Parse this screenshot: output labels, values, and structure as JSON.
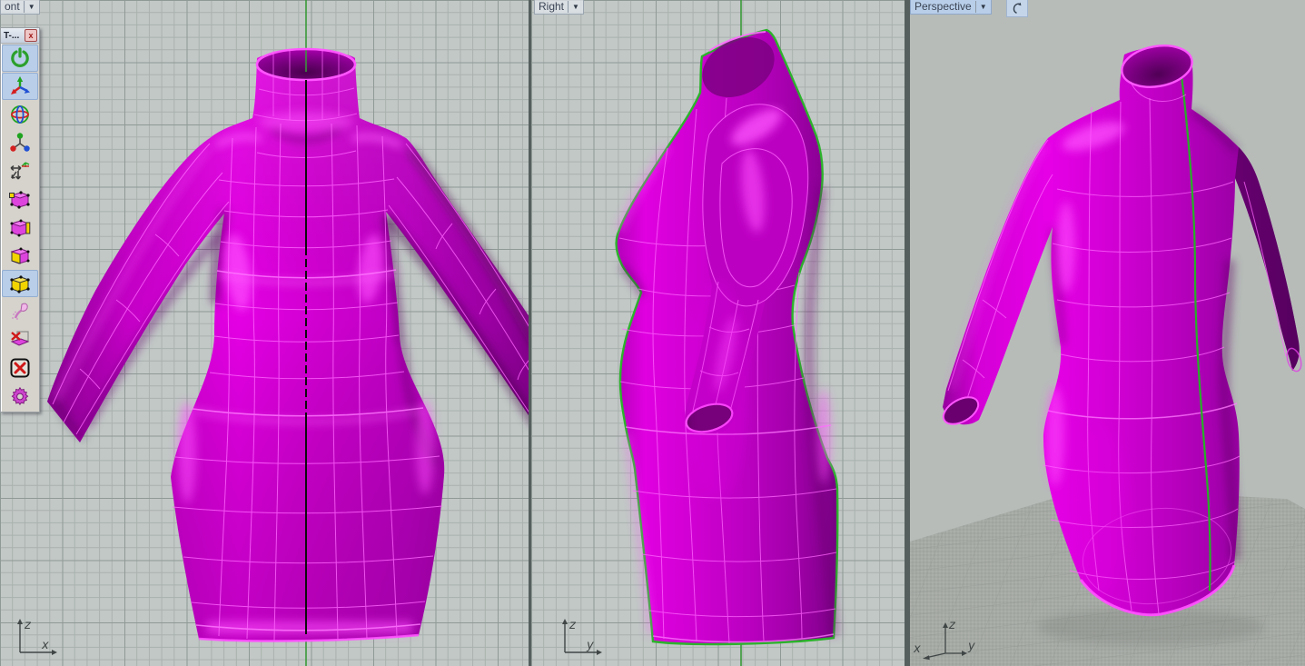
{
  "ui": {
    "dropdown_glyph": "▼",
    "close_glyph": "x",
    "rotate_icon": "view-rotate-icon"
  },
  "viewports": {
    "front": {
      "label": "ont",
      "axis_vertical": "z",
      "axis_horizontal": "x"
    },
    "right": {
      "label": "Right",
      "axis_vertical": "z",
      "axis_horizontal": "y"
    },
    "perspective": {
      "label": "Perspective",
      "axis_vertical": "z",
      "axis_left": "x",
      "axis_right": "y"
    }
  },
  "toolbar": {
    "title": "T-...",
    "buttons": [
      {
        "icon": "power-toggle-icon",
        "active": true
      },
      {
        "icon": "axis-tripod-icon",
        "active": true
      },
      {
        "icon": "gimbal-sphere-icon",
        "active": false
      },
      {
        "icon": "axis-balls-icon",
        "active": false
      },
      {
        "icon": "move-arrows-icon",
        "active": false
      },
      {
        "icon": "cube-vertex-icon",
        "active": false
      },
      {
        "icon": "cube-edge-icon",
        "active": false
      },
      {
        "icon": "cube-face-icon",
        "active": false
      },
      {
        "icon": "cube-solid-icon",
        "active": true
      },
      {
        "icon": "paint-brush-icon",
        "active": false
      },
      {
        "icon": "delete-face-icon",
        "active": false
      },
      {
        "icon": "cancel-box-icon",
        "active": false
      },
      {
        "icon": "gear-icon",
        "active": false
      }
    ]
  },
  "colors": {
    "model_magenta": "#cc00cc",
    "wireframe_pink": "#ff66ff",
    "seam_green": "#2ab32a",
    "grid_background": "#c2c8c6",
    "grid_minor": "#a9b1ae",
    "grid_major": "#8f9995",
    "perspective_sky": "#b7bcb9",
    "ground_gray": "#a6aaa5",
    "active_label_blue": "#b9cfe9"
  }
}
